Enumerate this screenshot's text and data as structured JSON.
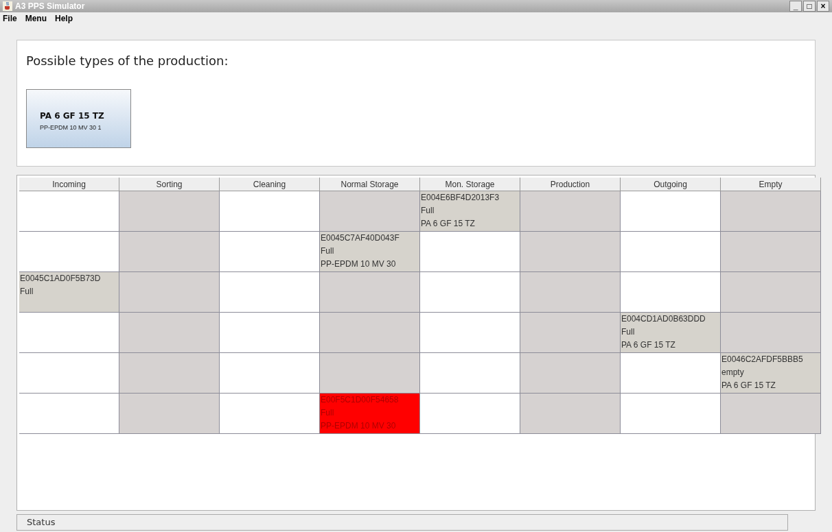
{
  "window": {
    "title": "A3 PPS Simulator",
    "controls": [
      "_",
      "□",
      "×"
    ]
  },
  "menu": [
    "File",
    "Menu",
    "Help"
  ],
  "production": {
    "heading": "Possible types of the production:",
    "button": {
      "title": "PA 6 GF 15 TZ",
      "subtitle": "PP-EPDM 10 MV 30 1"
    }
  },
  "table": {
    "columns": [
      "Incoming",
      "Sorting",
      "Cleaning",
      "Normal Storage",
      "Mon. Storage",
      "Production",
      "Outgoing",
      "Empty"
    ],
    "rows": [
      {
        "cells": [
          null,
          null,
          null,
          null,
          {
            "lines": [
              "E004E6BF4D2013F3",
              "Full",
              "PA 6 GF 15 TZ"
            ],
            "alert": false
          },
          null,
          null,
          null
        ]
      },
      {
        "cells": [
          null,
          null,
          null,
          {
            "lines": [
              "E0045C7AF40D043F",
              "Full",
              "PP-EPDM 10 MV 30"
            ],
            "alert": false
          },
          null,
          null,
          null,
          null
        ]
      },
      {
        "cells": [
          {
            "lines": [
              "E0045C1AD0F5B73D",
              "Full"
            ],
            "alert": false
          },
          null,
          null,
          null,
          null,
          null,
          null,
          null
        ]
      },
      {
        "cells": [
          null,
          null,
          null,
          null,
          null,
          null,
          {
            "lines": [
              "E004CD1AD0B63DDD",
              "Full",
              "PA 6 GF 15 TZ"
            ],
            "alert": false
          },
          null
        ]
      },
      {
        "cells": [
          null,
          null,
          null,
          null,
          null,
          null,
          null,
          {
            "lines": [
              "E0046C2AFDF5BBB5",
              "empty",
              "PA 6 GF 15 TZ"
            ],
            "alert": false
          }
        ]
      },
      {
        "cells": [
          null,
          null,
          null,
          {
            "lines": [
              "E00F5C1D00F54658",
              "Full",
              "PP-EPDM 10 MV 30"
            ],
            "alert": true
          },
          null,
          null,
          null,
          null
        ]
      }
    ]
  },
  "status_bar": "Status"
}
